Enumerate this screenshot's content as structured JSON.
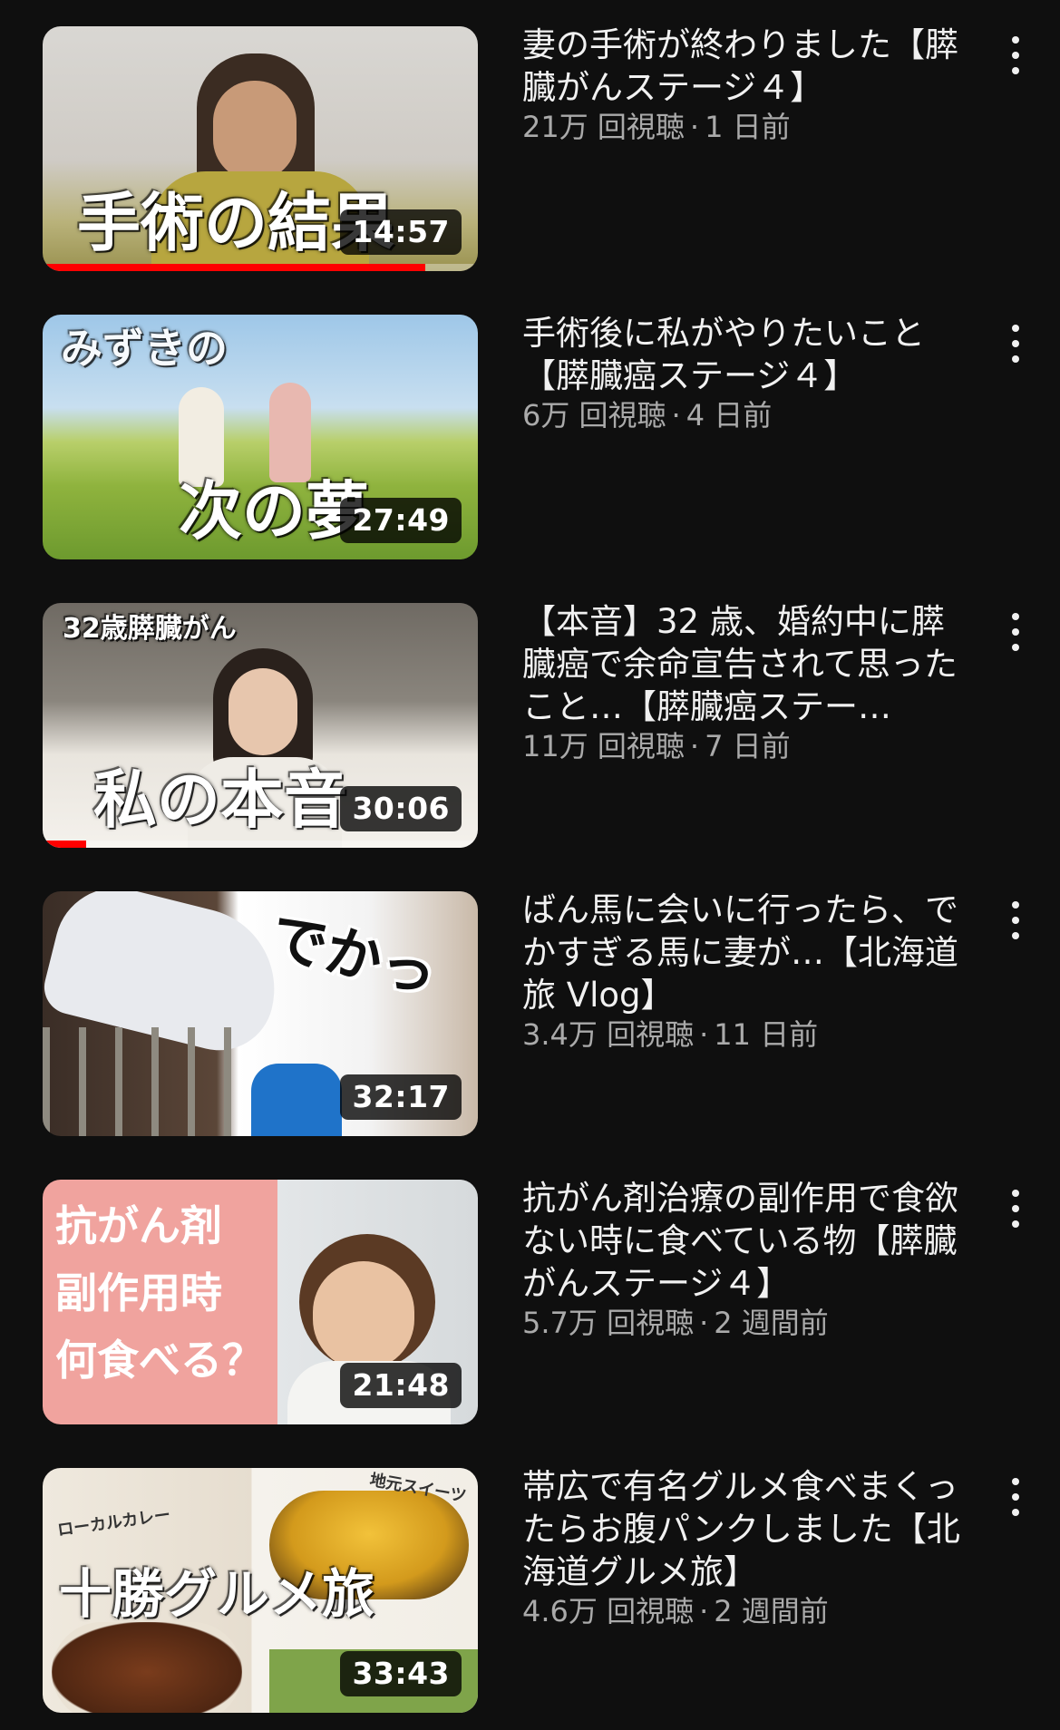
{
  "colors": {
    "background": "#0f0f0f",
    "title_text": "#f1f1f1",
    "meta_text": "#aaaaaa",
    "progress_red": "#ff0000"
  },
  "icons": {
    "more": "vertical-ellipsis-icon"
  },
  "videos": [
    {
      "thumb_text": "手術の結果",
      "duration": "14:57",
      "watch_progress": 0.88,
      "title": "妻の手術が終わりました【膵臓がんステージ４】",
      "views": "21万 回視聴",
      "age": "1 日前"
    },
    {
      "thumb_text": [
        "みずきの",
        "次の夢"
      ],
      "duration": "27:49",
      "watch_progress": 0,
      "title": "手術後に私がやりたいこと【膵臓癌ステージ４】",
      "views": "6万 回視聴",
      "age": "4 日前"
    },
    {
      "thumb_text": [
        "32歳膵臓がん",
        "私の本音"
      ],
      "duration": "30:06",
      "watch_progress": 0.1,
      "title": "【本音】32 歳、婚約中に膵臓癌で余命宣告されて思ったこと…【膵臓癌ステー…",
      "views": "11万 回視聴",
      "age": "7 日前"
    },
    {
      "thumb_text": "でかっ",
      "duration": "32:17",
      "watch_progress": 0,
      "title": "ばん馬に会いに行ったら、でかすぎる馬に妻が…【北海道旅 Vlog】",
      "views": "3.4万 回視聴",
      "age": "11 日前"
    },
    {
      "thumb_text": [
        "抗がん剤",
        "副作用時",
        "何食べる？"
      ],
      "duration": "21:48",
      "watch_progress": 0,
      "title": "抗がん剤治療の副作用で食欲ない時に食べている物【膵臓がんステージ４】",
      "views": "5.7万 回視聴",
      "age": "2 週間前"
    },
    {
      "thumb_text": [
        "十勝グルメ旅",
        "ローカルカレー",
        "地元スイーツ"
      ],
      "duration": "33:43",
      "watch_progress": 0,
      "title": "帯広で有名グルメ食べまくったらお腹パンクしました【北海道グルメ旅】",
      "views": "4.6万 回視聴",
      "age": "2 週間前"
    }
  ]
}
